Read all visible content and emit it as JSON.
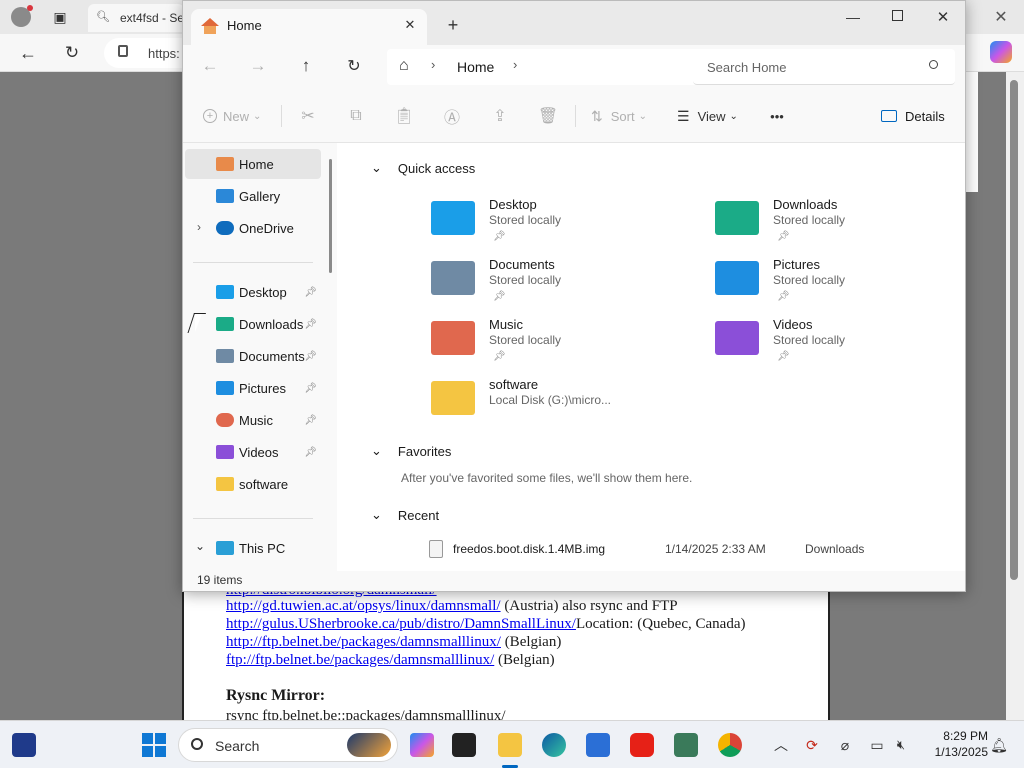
{
  "browser": {
    "tab_title": "ext4fsd - Se",
    "url_prefix": "https:",
    "page": {
      "partial_top_link": "http://distro.ibiblio.org/damnsmall/",
      "mirrors": [
        {
          "link": "http://gd.tuwien.ac.at/opsys/linux/damnsmall/",
          "note": " (Austria) also rsync and FTP"
        },
        {
          "link": "http://gulus.USherbrooke.ca/pub/distro/DamnSmallLinux/",
          "note": "Location: (Quebec, Canada)"
        },
        {
          "link": "http://ftp.belnet.be/packages/damnsmalllinux/",
          "note": " (Belgian)"
        },
        {
          "link": "ftp://ftp.belnet.be/packages/damnsmalllinux/",
          "note": " (Belgian)"
        }
      ],
      "rsync_heading": "Rysnc Mirror:",
      "rsync_partial": "rsync ftp.belnet.be::packages/damnsmalllinux/"
    }
  },
  "explorer": {
    "tab_title": "Home",
    "breadcrumb": "Home",
    "search_placeholder": "Search Home",
    "toolbar": {
      "new": "New",
      "sort": "Sort",
      "view": "View",
      "more": "•••",
      "details": "Details"
    },
    "nav": {
      "top": [
        {
          "label": "Home",
          "icon": "home-icon"
        },
        {
          "label": "Gallery",
          "icon": "gallery-icon"
        },
        {
          "label": "OneDrive",
          "icon": "cloud-icon"
        }
      ],
      "pinned": [
        {
          "label": "Desktop",
          "icon": "desktop-icon"
        },
        {
          "label": "Downloads",
          "icon": "download-icon"
        },
        {
          "label": "Documents",
          "icon": "document-icon"
        },
        {
          "label": "Pictures",
          "icon": "pictures-icon"
        },
        {
          "label": "Music",
          "icon": "music-icon"
        },
        {
          "label": "Videos",
          "icon": "video-icon"
        },
        {
          "label": "software",
          "icon": "folder-icon"
        }
      ],
      "this_pc": "This PC"
    },
    "sections": {
      "quick_access": "Quick access",
      "favorites": "Favorites",
      "favorites_empty": "After you've favorited some files, we'll show them here.",
      "recent": "Recent"
    },
    "quick_access": [
      {
        "name": "Desktop",
        "location": "Stored locally",
        "pinned": true,
        "color": "#1a9ee8"
      },
      {
        "name": "Downloads",
        "location": "Stored locally",
        "pinned": true,
        "color": "#1bab87"
      },
      {
        "name": "Documents",
        "location": "Stored locally",
        "pinned": true,
        "color": "#6f8aa4"
      },
      {
        "name": "Pictures",
        "location": "Stored locally",
        "pinned": true,
        "color": "#1e8ee0"
      },
      {
        "name": "Music",
        "location": "Stored locally",
        "pinned": true,
        "color": "#e0684e"
      },
      {
        "name": "Videos",
        "location": "Stored locally",
        "pinned": true,
        "color": "#8b4fd8"
      },
      {
        "name": "software",
        "location": "Local Disk (G:)\\micro...",
        "pinned": false,
        "color": "#f4c542"
      }
    ],
    "recent": [
      {
        "name": "freedos.boot.disk.1.4MB.img",
        "date": "1/14/2025 2:33 AM",
        "location": "Downloads"
      }
    ],
    "status": "19 items"
  },
  "taskbar": {
    "search": "Search",
    "time": "8:29 PM",
    "date": "1/13/2025"
  },
  "colors": {
    "accent": "#0067c0",
    "nav_selected": "#e5e5e5",
    "link": "#0000ee"
  }
}
